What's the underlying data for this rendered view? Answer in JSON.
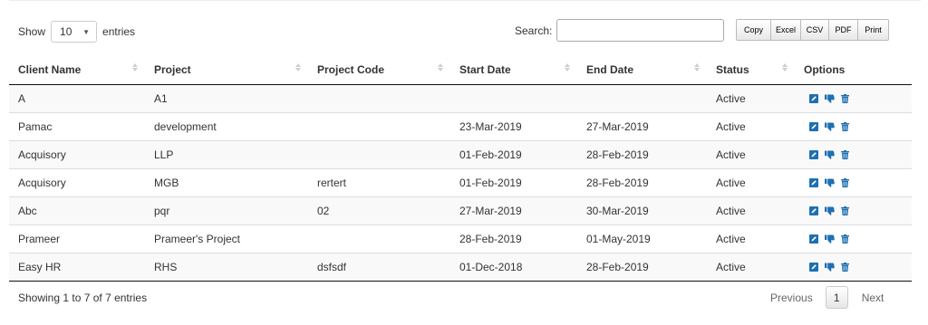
{
  "length": {
    "show_label": "Show",
    "value": "10",
    "entries_label": "entries"
  },
  "search": {
    "label": "Search:",
    "value": ""
  },
  "export_buttons": [
    "Copy",
    "Excel",
    "CSV",
    "PDF",
    "Print"
  ],
  "table": {
    "headers": [
      "Client Name",
      "Project",
      "Project Code",
      "Start Date",
      "End Date",
      "Status",
      "Options"
    ],
    "rows": [
      {
        "client": "A",
        "project": "A1",
        "code": "",
        "start": "",
        "end": "",
        "status": "Active"
      },
      {
        "client": "Pamac",
        "project": "development",
        "code": "",
        "start": "23-Mar-2019",
        "end": "27-Mar-2019",
        "status": "Active"
      },
      {
        "client": "Acquisory",
        "project": "LLP",
        "code": "",
        "start": "01-Feb-2019",
        "end": "28-Feb-2019",
        "status": "Active"
      },
      {
        "client": "Acquisory",
        "project": "MGB",
        "code": "rertert",
        "start": "01-Feb-2019",
        "end": "28-Feb-2019",
        "status": "Active"
      },
      {
        "client": "Abc",
        "project": "pqr",
        "code": "02",
        "start": "27-Mar-2019",
        "end": "30-Mar-2019",
        "status": "Active"
      },
      {
        "client": "Prameer",
        "project": "Prameer's Project",
        "code": "",
        "start": "28-Feb-2019",
        "end": "01-May-2019",
        "status": "Active"
      },
      {
        "client": "Easy HR",
        "project": "RHS",
        "code": "dsfsdf",
        "start": "01-Dec-2018",
        "end": "28-Feb-2019",
        "status": "Active"
      }
    ],
    "row_icons": [
      "edit-icon",
      "thumbs-down-icon",
      "trash-icon"
    ]
  },
  "footer": {
    "info": "Showing 1 to 7 of 7 entries",
    "previous": "Previous",
    "current_page": "1",
    "next": "Next"
  },
  "colors": {
    "icon_blue": "#1e6fb3",
    "header_rule": "#111111",
    "stripe": "#f9f9f9"
  }
}
